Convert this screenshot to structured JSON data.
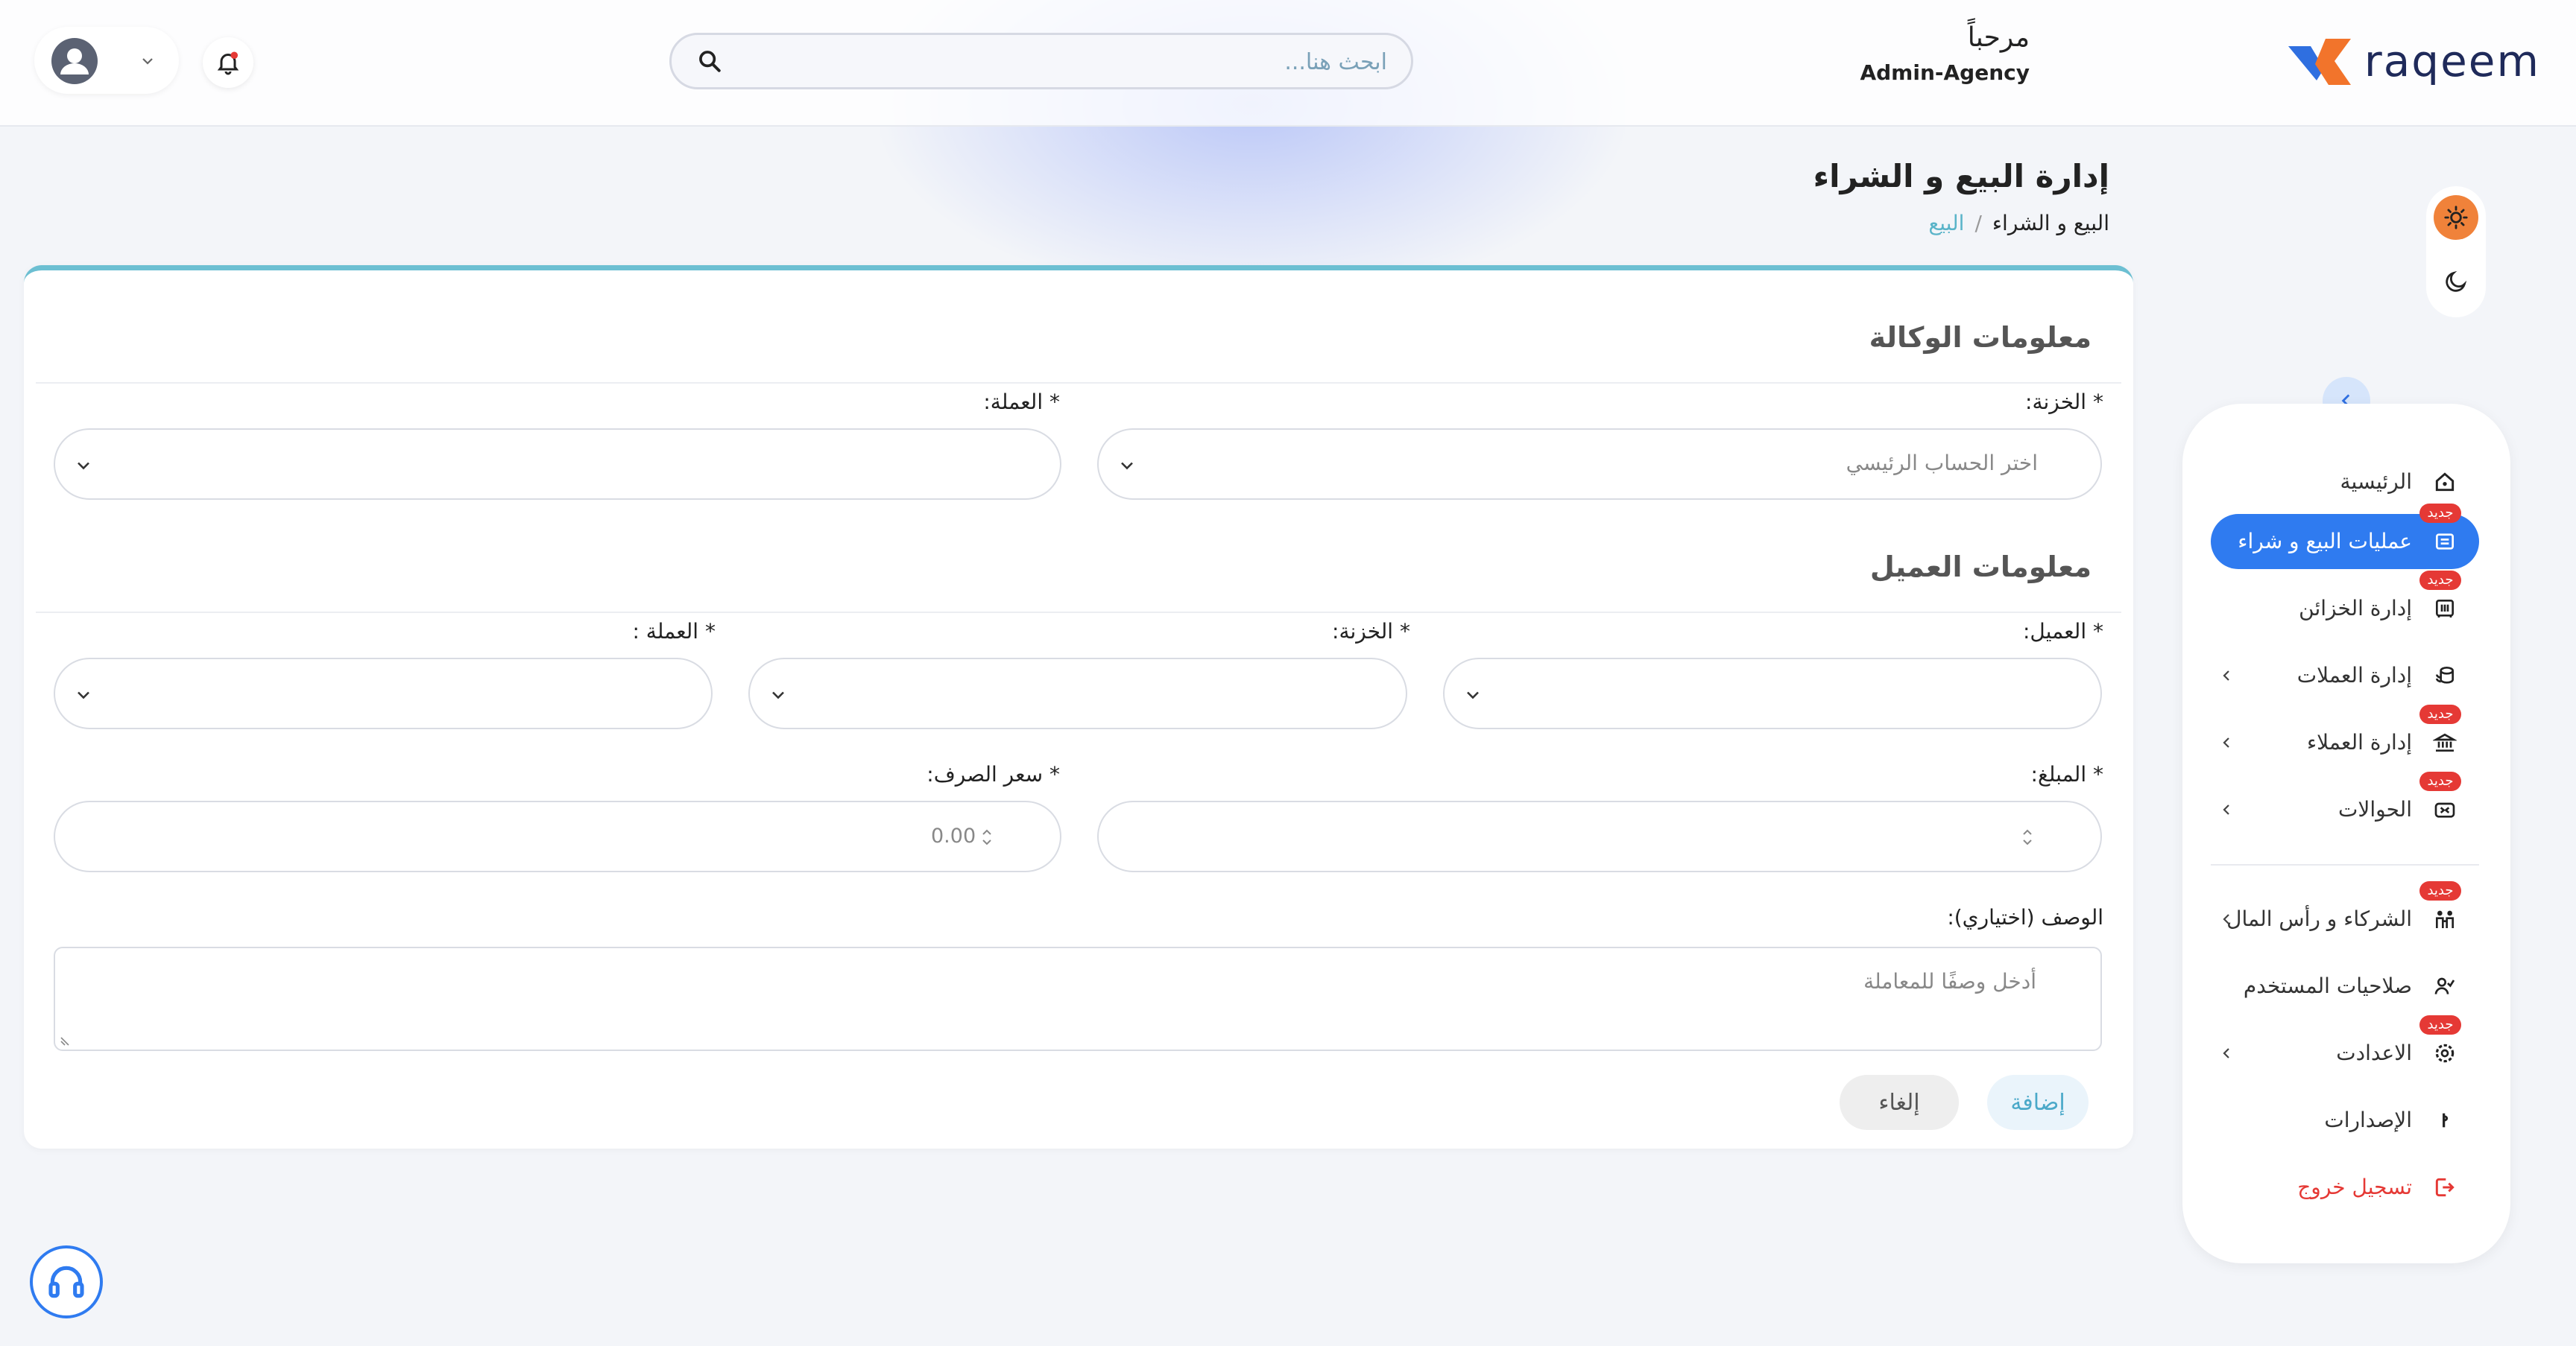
{
  "header": {
    "brand": "raqeem",
    "welcome": "مرحباً",
    "user_name": "Admin-Agency",
    "search_placeholder": "ابحث هنا..."
  },
  "page": {
    "title": "إدارة البيع و الشراء",
    "breadcrumb": [
      "البيع و الشراء",
      "/",
      "البيع"
    ]
  },
  "sidebar": {
    "items": [
      {
        "label": "الرئيسية",
        "icon": "home-icon"
      },
      {
        "label": "عمليات البيع و شراء",
        "icon": "exchange-icon",
        "badge": "جديد",
        "active": true
      },
      {
        "label": "إدارة الخزائن",
        "icon": "safe-icon",
        "badge": "جديد"
      },
      {
        "label": "إدارة العملات",
        "icon": "coins-icon"
      },
      {
        "label": "إدارة العملاء",
        "icon": "bank-icon",
        "badge": "جديد"
      },
      {
        "label": "الحوالات",
        "icon": "transfer-icon",
        "badge": "جديد"
      },
      {
        "label": "الشركاء و رأس المال",
        "icon": "partners-icon",
        "badge": "جديد"
      },
      {
        "label": "صلاحيات المستخدم",
        "icon": "user-permissions-icon"
      },
      {
        "label": "الاعدادت",
        "icon": "settings-icon",
        "badge": "جديد"
      },
      {
        "label": "الإصدارات",
        "icon": "versions-icon"
      },
      {
        "label": "تسجيل خروج",
        "icon": "logout-icon"
      }
    ]
  },
  "agency_section": {
    "title": "معلومات الوكالة",
    "treasury_label": "* الخزنة:",
    "treasury_placeholder": "اختر الحساب الرئيسي",
    "currency_label": "* العملة:"
  },
  "client_section": {
    "title": "معلومات العميل",
    "client_label": "* العميل:",
    "treasury_label": "* الخزنة:",
    "currency_label": "* العملة :",
    "amount_label": "* المبلغ:",
    "rate_label": "* سعر الصرف:",
    "rate_value": "0.00",
    "description_label": "الوصف (اختياري):",
    "description_placeholder": "أدخل وصفًا للمعاملة"
  },
  "actions": {
    "add": "إضافة",
    "cancel": "إلغاء"
  },
  "colors": {
    "accent": "#2f7bf0",
    "badge": "#e53935",
    "card_border": "#6cbfd2",
    "sun": "#f0823a"
  }
}
